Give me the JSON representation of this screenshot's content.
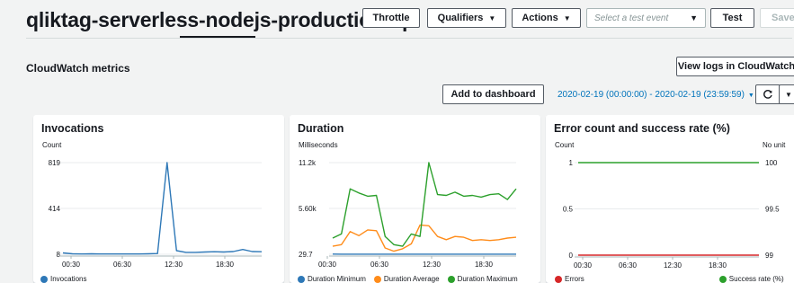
{
  "header": {
    "title": "qliktag-serverless-nodejs-production-api",
    "throttle": "Throttle",
    "qualifiers": "Qualifiers",
    "actions": "Actions",
    "test_event_placeholder": "Select a test event",
    "test": "Test",
    "save": "Save"
  },
  "metrics": {
    "title": "CloudWatch metrics",
    "view_logs": "View logs in CloudWatch",
    "add_dashboard": "Add to dashboard",
    "time_range": "2020-02-19 (00:00:00) - 2020-02-19 (23:59:59)"
  },
  "chart_data": [
    {
      "type": "line",
      "title": "Invocations",
      "ylabel": "Count",
      "ylim": [
        8,
        819
      ],
      "y_ticks": [
        "819",
        "414",
        "8"
      ],
      "x_ticks": [
        "00:30",
        "06:30",
        "12:30",
        "18:30"
      ],
      "x": [
        "00:00",
        "01:00",
        "02:00",
        "03:00",
        "04:00",
        "05:00",
        "06:00",
        "07:00",
        "08:00",
        "09:00",
        "10:00",
        "11:00",
        "12:00",
        "13:00",
        "14:00",
        "15:00",
        "16:00",
        "17:00",
        "18:00",
        "19:00",
        "20:00",
        "21:00"
      ],
      "series": [
        {
          "name": "Invocations",
          "color": "#2e78b7",
          "values": [
            20,
            12,
            10,
            12,
            10,
            10,
            10,
            10,
            10,
            12,
            14,
            819,
            40,
            25,
            25,
            28,
            30,
            28,
            32,
            50,
            32,
            30
          ]
        }
      ]
    },
    {
      "type": "line",
      "title": "Duration",
      "ylabel": "Milliseconds",
      "ylim": [
        29.7,
        11200
      ],
      "y_ticks": [
        "11.2k",
        "5.60k",
        "29.7"
      ],
      "x_ticks": [
        "00:30",
        "06:30",
        "12:30",
        "18:30"
      ],
      "x": [
        "00:00",
        "01:00",
        "02:00",
        "03:00",
        "04:00",
        "05:00",
        "06:00",
        "07:00",
        "08:00",
        "09:00",
        "10:00",
        "11:00",
        "12:00",
        "13:00",
        "14:00",
        "15:00",
        "16:00",
        "17:00",
        "18:00",
        "19:00",
        "20:00",
        "21:00"
      ],
      "series": [
        {
          "name": "Duration Minimum",
          "color": "#2e78b7",
          "values": [
            50,
            45,
            45,
            45,
            45,
            45,
            45,
            45,
            45,
            45,
            45,
            45,
            45,
            45,
            45,
            45,
            45,
            45,
            45,
            45,
            45,
            45
          ]
        },
        {
          "name": "Duration Average",
          "color": "#ff8c1a",
          "values": [
            1000,
            1200,
            2800,
            2300,
            3000,
            2900,
            800,
            400,
            700,
            1300,
            3600,
            3500,
            2200,
            1800,
            2200,
            2100,
            1700,
            1800,
            1700,
            1800,
            2000,
            2100
          ]
        },
        {
          "name": "Duration Maximum",
          "color": "#2ca02c",
          "values": [
            2000,
            2500,
            8000,
            7500,
            7100,
            7200,
            2200,
            1200,
            1000,
            2500,
            2200,
            11200,
            7300,
            7200,
            7600,
            7100,
            7200,
            7000,
            7300,
            7400,
            6700,
            8000
          ]
        }
      ]
    },
    {
      "type": "line",
      "title": "Error count and success rate (%)",
      "ylabel": "Count",
      "y2label": "No unit",
      "ylim": [
        0,
        1
      ],
      "y2lim": [
        99,
        100
      ],
      "y_ticks": [
        "1",
        "0.5",
        "0"
      ],
      "y2_ticks": [
        "100",
        "99.5",
        "99"
      ],
      "x_ticks": [
        "00:30",
        "06:30",
        "12:30",
        "18:30"
      ],
      "series": [
        {
          "name": "Errors",
          "color": "#d62728",
          "axis": "left",
          "values": [
            0,
            0,
            0,
            0,
            0,
            0,
            0,
            0,
            0,
            0,
            0,
            0,
            0,
            0,
            0,
            0,
            0,
            0,
            0,
            0,
            0,
            0
          ]
        },
        {
          "name": "Success rate (%)",
          "color": "#2ca02c",
          "axis": "right",
          "values": [
            100,
            100,
            100,
            100,
            100,
            100,
            100,
            100,
            100,
            100,
            100,
            100,
            100,
            100,
            100,
            100,
            100,
            100,
            100,
            100,
            100,
            100
          ]
        }
      ]
    }
  ]
}
